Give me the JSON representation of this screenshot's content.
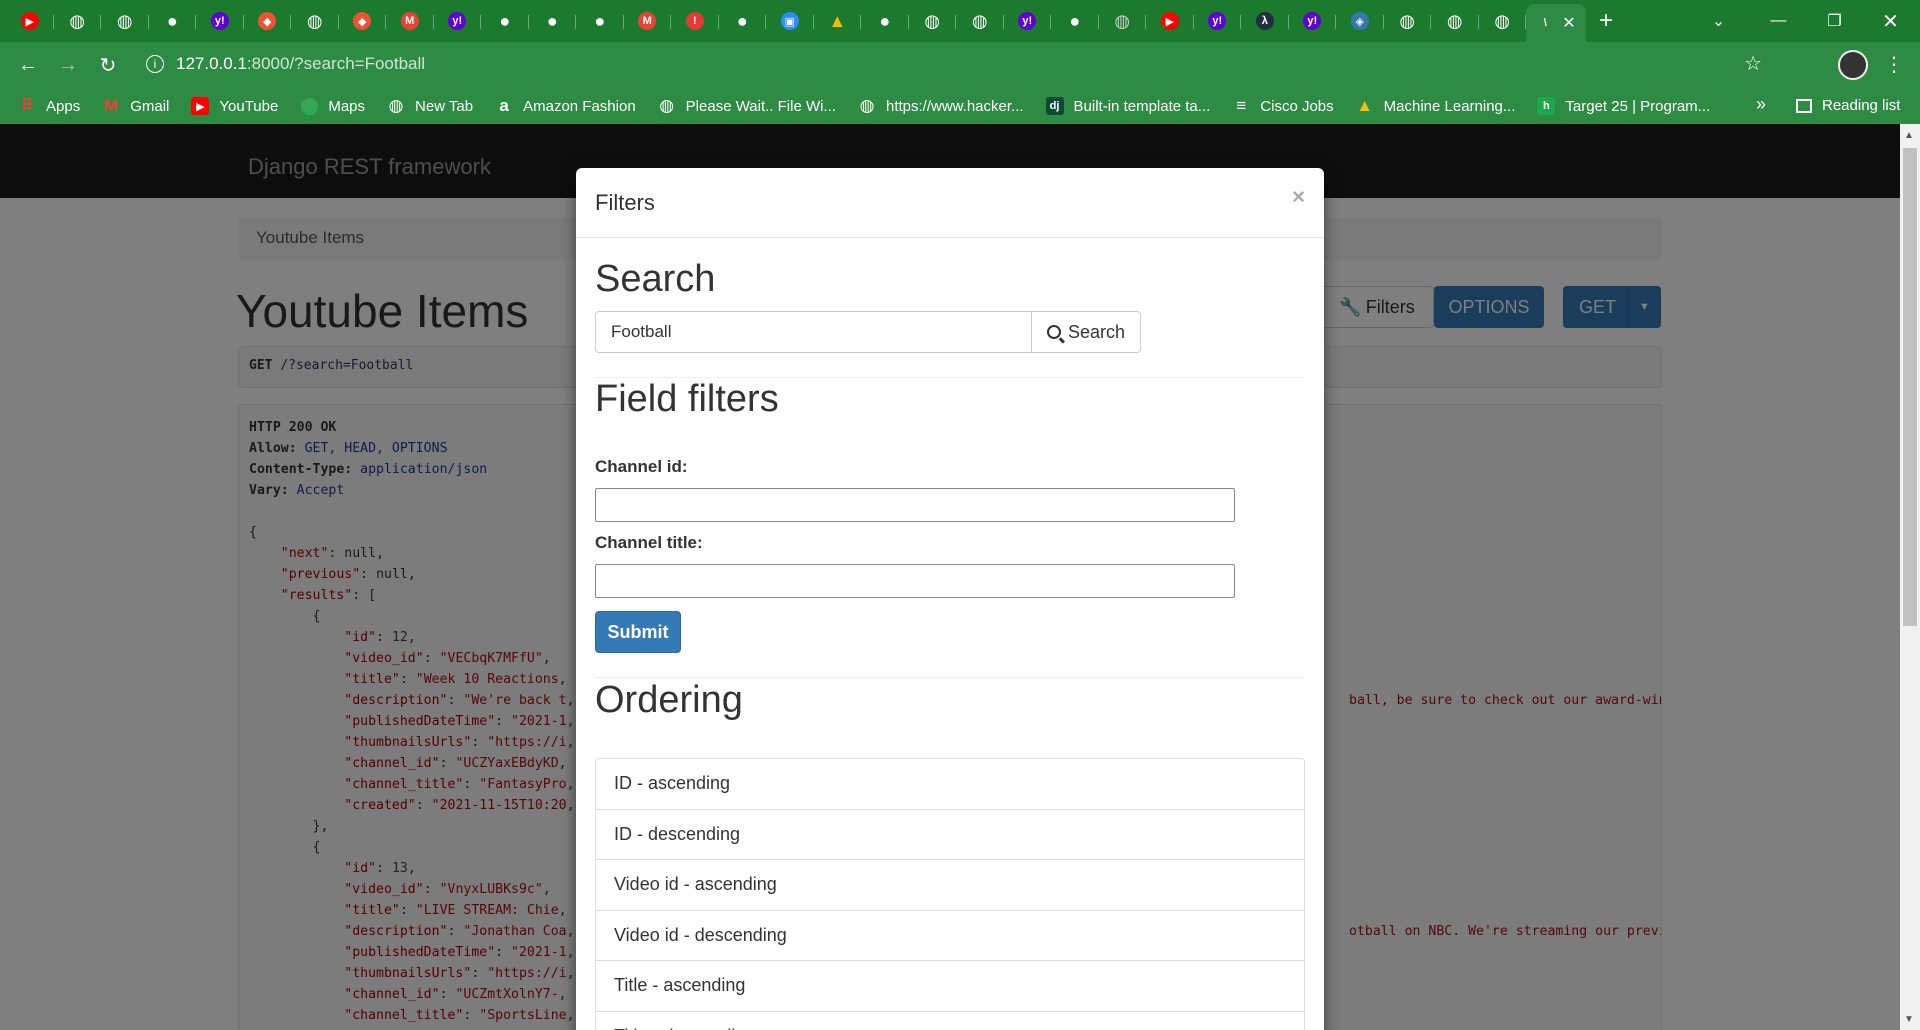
{
  "browser": {
    "tabs": [
      {
        "icon": "youtube-icon",
        "color": "#ff0000",
        "glyph": "▶"
      },
      {
        "icon": "globe-icon",
        "color": "#ffffff",
        "glyph": "◍"
      },
      {
        "icon": "globe-icon",
        "color": "#ffffff",
        "glyph": "◍"
      },
      {
        "icon": "github-icon",
        "color": "#ffffff",
        "glyph": "●"
      },
      {
        "icon": "yahoo-icon",
        "color": "#6001d2",
        "glyph": "y!"
      },
      {
        "icon": "git-icon",
        "color": "#f05133",
        "glyph": "◆"
      },
      {
        "icon": "globe-icon",
        "color": "#ffffff",
        "glyph": "◍"
      },
      {
        "icon": "git-icon",
        "color": "#f05133",
        "glyph": "◆"
      },
      {
        "icon": "gmail-icon",
        "color": "#ea4335",
        "glyph": "M"
      },
      {
        "icon": "yahoo-icon",
        "color": "#6001d2",
        "glyph": "y!"
      },
      {
        "icon": "github-icon",
        "color": "#ffffff",
        "glyph": "●"
      },
      {
        "icon": "github-icon",
        "color": "#ffffff",
        "glyph": "●"
      },
      {
        "icon": "github-icon",
        "color": "#ffffff",
        "glyph": "●"
      },
      {
        "icon": "gmail-icon",
        "color": "#ea4335",
        "glyph": "M"
      },
      {
        "icon": "alert-icon",
        "color": "#e53935",
        "glyph": "!"
      },
      {
        "icon": "github-icon",
        "color": "#ffffff",
        "glyph": "●"
      },
      {
        "icon": "zoom-icon",
        "color": "#2d8cff",
        "glyph": "▣"
      },
      {
        "icon": "drive-icon",
        "color": "#fbbc04",
        "glyph": "▲"
      },
      {
        "icon": "github-icon",
        "color": "#ffffff",
        "glyph": "●"
      },
      {
        "icon": "globe-icon",
        "color": "#ffffff",
        "glyph": "◍"
      },
      {
        "icon": "globe-icon",
        "color": "#ffffff",
        "glyph": "◍"
      },
      {
        "icon": "yahoo-icon",
        "color": "#6001d2",
        "glyph": "y!"
      },
      {
        "icon": "github-icon",
        "color": "#ffffff",
        "glyph": "●"
      },
      {
        "icon": "globe-icon",
        "color": "#cccccc",
        "glyph": "◍"
      },
      {
        "icon": "youtube-icon",
        "color": "#ff0000",
        "glyph": "▶"
      },
      {
        "icon": "yahoo-icon",
        "color": "#6001d2",
        "glyph": "y!"
      },
      {
        "icon": "aws-icon",
        "color": "#232f3e",
        "glyph": "λ"
      },
      {
        "icon": "yahoo-icon",
        "color": "#6001d2",
        "glyph": "y!"
      },
      {
        "icon": "python-icon",
        "color": "#3776ab",
        "glyph": "◈"
      },
      {
        "icon": "globe-icon",
        "color": "#ffffff",
        "glyph": "◍"
      },
      {
        "icon": "globe-icon",
        "color": "#ffffff",
        "glyph": "◍"
      },
      {
        "icon": "globe-icon",
        "color": "#ffffff",
        "glyph": "◍"
      }
    ],
    "active_tab_glyph": "\\",
    "url_host": "127.0.0.1",
    "url_path": ":8000/?search=Football",
    "bookmarks": [
      {
        "label": "Apps",
        "icon": "apps-grid-icon",
        "color": "#ea4335",
        "glyph": "⠿"
      },
      {
        "label": "Gmail",
        "icon": "gmail-icon",
        "color": "#ea4335",
        "glyph": "M"
      },
      {
        "label": "YouTube",
        "icon": "youtube-icon",
        "color": "#ff0000",
        "glyph": "▶"
      },
      {
        "label": "Maps",
        "icon": "maps-pin-icon",
        "color": "#34a853",
        "glyph": "⬤"
      },
      {
        "label": "New Tab",
        "icon": "globe-icon",
        "color": "#ffffff",
        "glyph": "◍"
      },
      {
        "label": "Amazon Fashion",
        "icon": "amazon-icon",
        "color": "#ffffff",
        "glyph": "a"
      },
      {
        "label": "Please Wait.. File Wi...",
        "icon": "globe-icon",
        "color": "#ffffff",
        "glyph": "◍"
      },
      {
        "label": "https://www.hacker...",
        "icon": "globe-icon",
        "color": "#ffffff",
        "glyph": "◍"
      },
      {
        "label": "Built-in template ta...",
        "icon": "django-icon",
        "color": "#0c4b33",
        "glyph": "dj"
      },
      {
        "label": "Cisco Jobs",
        "icon": "cisco-icon",
        "color": "#ffffff",
        "glyph": "≡"
      },
      {
        "label": "Machine Learning...",
        "icon": "drive-icon",
        "color": "#fbbc04",
        "glyph": "▲"
      },
      {
        "label": "Target 25 | Program...",
        "icon": "hackerrank-icon",
        "color": "#1ba94c",
        "glyph": "h"
      }
    ],
    "reading_list": "Reading list"
  },
  "page": {
    "brand": "Django REST framework",
    "breadcrumb": "Youtube Items",
    "title": "Youtube Items",
    "buttons": {
      "filters": "Filters",
      "options": "OPTIONS",
      "get": "GET"
    },
    "request_method": "GET",
    "request_path": "/?search=Football",
    "response": {
      "status": "HTTP 200 OK",
      "allow": "GET, HEAD, OPTIONS",
      "content_type": "application/json",
      "vary": "Accept"
    },
    "results": [
      {
        "id": "12",
        "video_id": "\"VECbqK7MFfU\"",
        "title": "\"Week 10 Reactions",
        "description": "\"We're back t",
        "description_tail": "ball, be sure to check out our award-winn",
        "publishedDateTime": "\"2021-1",
        "thumbnailsUrls": "\"https://i",
        "channel_id": "\"UCZYaxEBdyKD",
        "channel_title": "\"FantasyPro",
        "created": "\"2021-11-15T10:20"
      },
      {
        "id": "13",
        "video_id": "\"VnyxLUBKs9c\"",
        "title": "\"LIVE STREAM: Chie",
        "description": "\"Jonathan Coa",
        "description_tail": "otball on NBC. We're streaming our previe",
        "publishedDateTime": "\"2021-1",
        "thumbnailsUrls": "\"https://i",
        "channel_id": "\"UCZmtXolnY7-",
        "channel_title": "\"SportsLine",
        "created": "\"2021-11-15T10:2"
      }
    ]
  },
  "modal": {
    "title": "Filters",
    "close": "×",
    "search_heading": "Search",
    "search_value": "Football",
    "search_button": "Search",
    "field_filters_heading": "Field filters",
    "channel_id_label": "Channel id:",
    "channel_id_value": "",
    "channel_title_label": "Channel title:",
    "channel_title_value": "",
    "submit": "Submit",
    "ordering_heading": "Ordering",
    "ordering": [
      "ID - ascending",
      "ID - descending",
      "Video id - ascending",
      "Video id - descending",
      "Title - ascending",
      "Title - descending"
    ]
  }
}
